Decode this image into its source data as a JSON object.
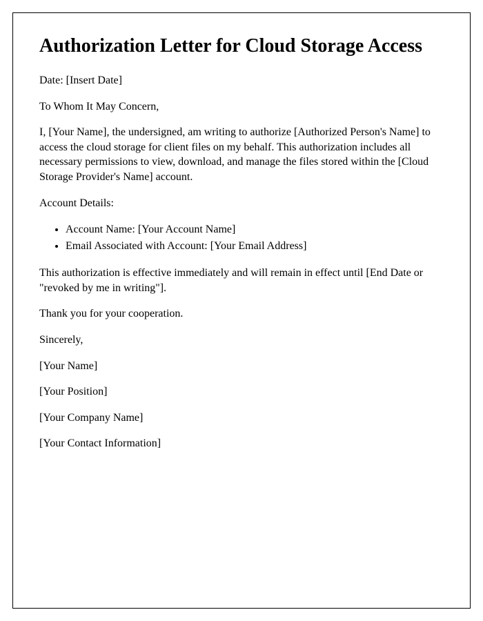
{
  "title": "Authorization Letter for Cloud Storage Access",
  "date_line": "Date: [Insert Date]",
  "salutation": "To Whom It May Concern,",
  "body_paragraph": "I, [Your Name], the undersigned, am writing to authorize [Authorized Person's Name] to access the cloud storage for client files on my behalf. This authorization includes all necessary permissions to view, download, and manage the files stored within the [Cloud Storage Provider's Name] account.",
  "account_details_label": "Account Details:",
  "account_items": {
    "account_name": "Account Name: [Your Account Name]",
    "email": "Email Associated with Account: [Your Email Address]"
  },
  "effective_paragraph": "This authorization is effective immediately and will remain in effect until [End Date or \"revoked by me in writing\"].",
  "thanks": "Thank you for your cooperation.",
  "closing": "Sincerely,",
  "signature": {
    "name": "[Your Name]",
    "position": "[Your Position]",
    "company": "[Your Company Name]",
    "contact": "[Your Contact Information]"
  }
}
